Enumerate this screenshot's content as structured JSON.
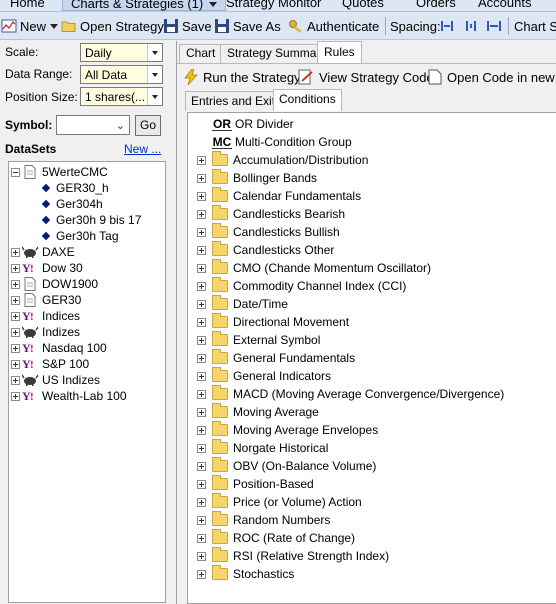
{
  "menubar": {
    "items": [
      "Home",
      "Charts & Strategies (1)",
      "Strategy Monitor",
      "Quotes",
      "Orders",
      "Accounts"
    ]
  },
  "toolbar": {
    "new_label": "New",
    "open_strategy_label": "Open Strategy",
    "save_label": "Save",
    "save_as_label": "Save As",
    "authenticate_label": "Authenticate",
    "spacing_label": "Spacing:",
    "chart_style_label": "Chart St"
  },
  "left_panel": {
    "scale_label": "Scale:",
    "scale_value": "Daily",
    "data_range_label": "Data Range:",
    "data_range_value": "All Data",
    "position_size_label": "Position Size:",
    "position_size_value": "1 shares(...",
    "symbol_label": "Symbol:",
    "symbol_value": "",
    "go_label": "Go",
    "datasets_label": "DataSets",
    "new_link": "New ...",
    "datasets": [
      {
        "name": "5WerteCMC",
        "expanded": true,
        "icon": "document-icon",
        "children": [
          "GER30_h",
          "Ger304h",
          "Ger30h 9 bis 17",
          "Ger30h Tag"
        ]
      },
      {
        "name": "DAXE",
        "icon": "bull-icon"
      },
      {
        "name": "Dow 30",
        "icon": "yahoo-icon"
      },
      {
        "name": "DOW1900",
        "icon": "document-icon"
      },
      {
        "name": "GER30",
        "icon": "document-icon"
      },
      {
        "name": "Indices",
        "icon": "yahoo-icon"
      },
      {
        "name": "Indizes",
        "icon": "bull-icon"
      },
      {
        "name": "Nasdaq 100",
        "icon": "yahoo-icon"
      },
      {
        "name": "S&P 100",
        "icon": "yahoo-icon"
      },
      {
        "name": "US Indizes",
        "icon": "bull-icon"
      },
      {
        "name": "Wealth-Lab 100",
        "icon": "yahoo-icon"
      }
    ]
  },
  "right_panel": {
    "tabs": [
      "Chart",
      "Strategy Summary",
      "Rules"
    ],
    "active_tab": "Rules",
    "actions": {
      "run_strategy": "Run the Strategy",
      "view_code": "View Strategy Code",
      "open_code": "Open Code in new St"
    },
    "subtabs": [
      "Entries and Exits",
      "Conditions"
    ],
    "active_subtab": "Conditions",
    "special_items": [
      {
        "badge": "OR",
        "label": "OR Divider"
      },
      {
        "badge": "MC",
        "label": "Multi-Condition Group"
      }
    ],
    "condition_groups": [
      "Accumulation/Distribution",
      "Bollinger Bands",
      "Calendar Fundamentals",
      "Candlesticks Bearish",
      "Candlesticks Bullish",
      "Candlesticks Other",
      "CMO (Chande Momentum Oscillator)",
      "Commodity Channel Index (CCI)",
      "Date/Time",
      "Directional Movement",
      "External Symbol",
      "General Fundamentals",
      "General Indicators",
      "MACD (Moving Average Convergence/Divergence)",
      "Moving Average",
      "Moving Average Envelopes",
      "Norgate Historical",
      "OBV (On-Balance Volume)",
      "Position-Based",
      "Price (or Volume) Action",
      "Random Numbers",
      "ROC (Rate of Change)",
      "RSI (Relative Strength Index)",
      "Stochastics"
    ]
  }
}
